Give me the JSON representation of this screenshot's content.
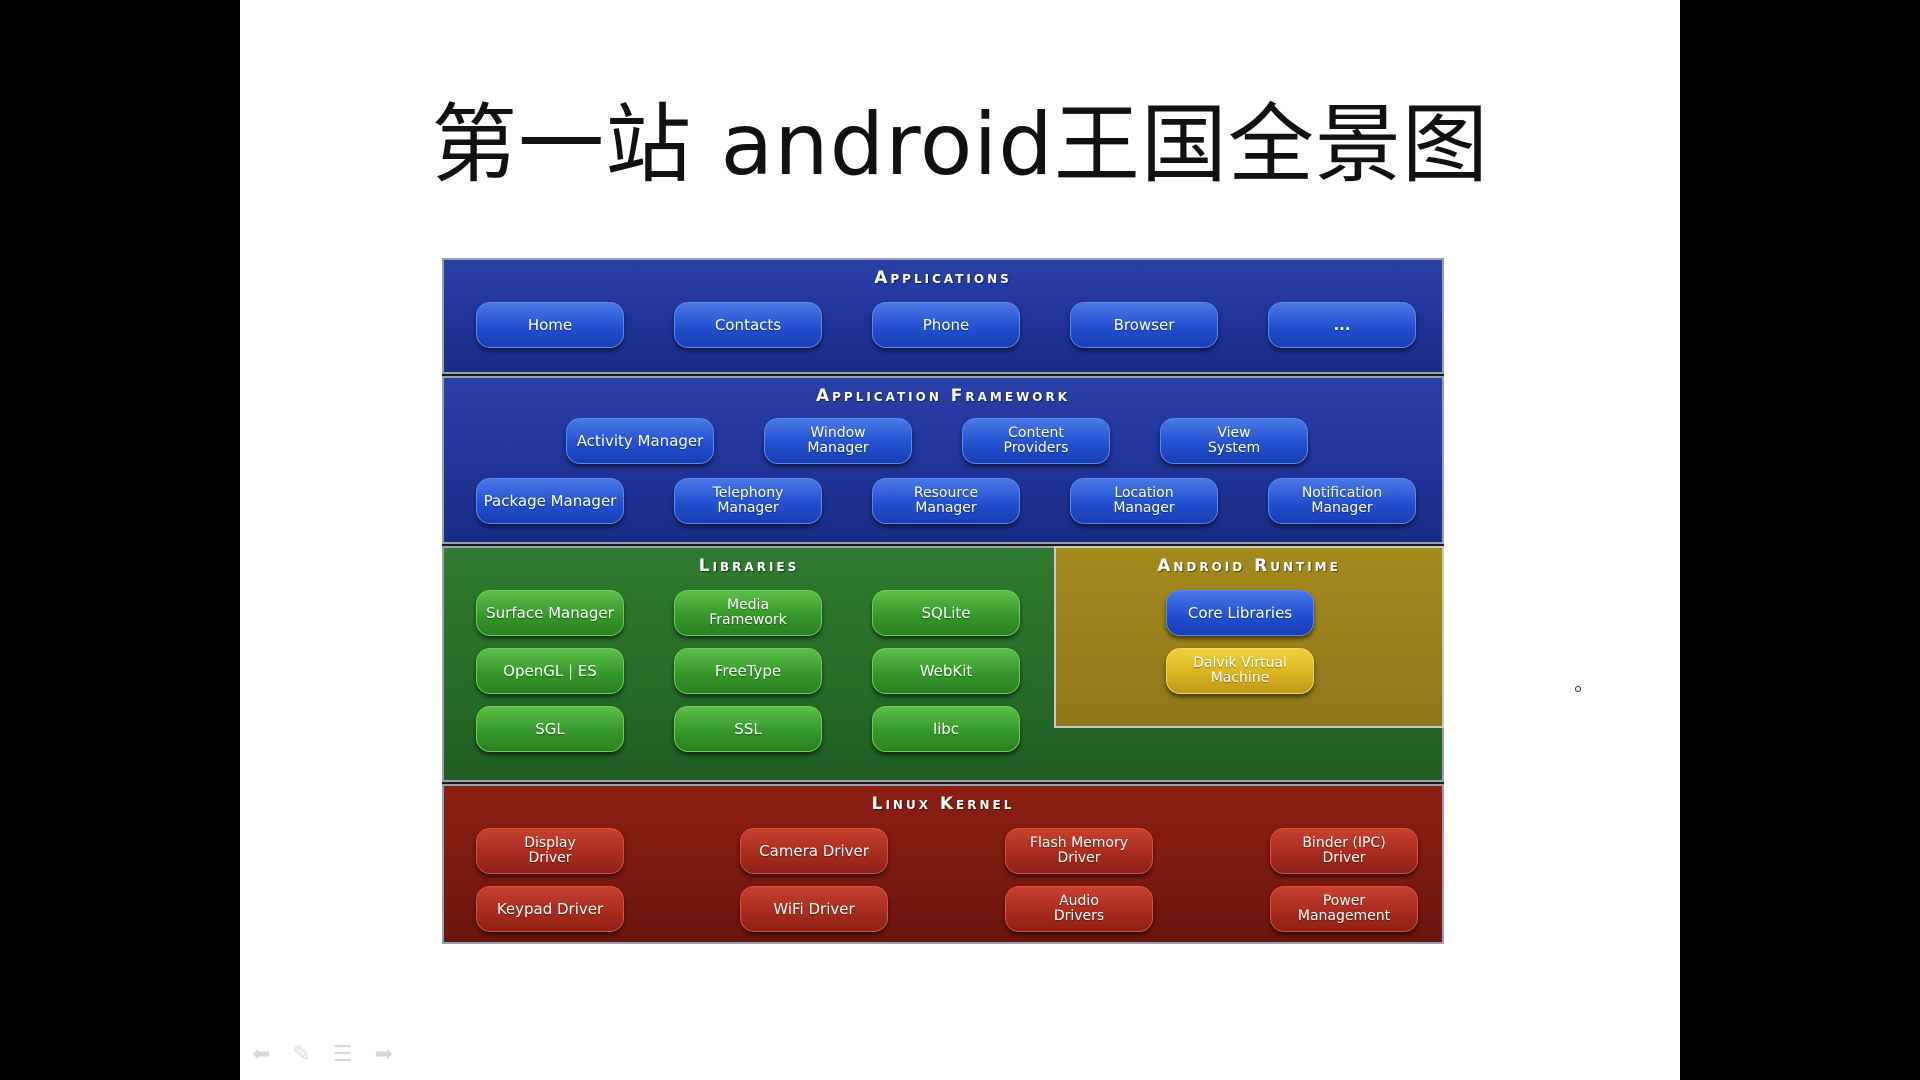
{
  "slide": {
    "title": "第一站 android王国全景图"
  },
  "diagram": {
    "applications": {
      "title": "Applications",
      "items": [
        "Home",
        "Contacts",
        "Phone",
        "Browser",
        "..."
      ]
    },
    "framework": {
      "title": "Application Framework",
      "row1": [
        "Activity Manager",
        "Window\nManager",
        "Content\nProviders",
        "View\nSystem"
      ],
      "row2": [
        "Package Manager",
        "Telephony\nManager",
        "Resource\nManager",
        "Location\nManager",
        "Notification\nManager"
      ]
    },
    "libraries": {
      "title": "Libraries",
      "items": [
        "Surface Manager",
        "Media\nFramework",
        "SQLite",
        "OpenGL | ES",
        "FreeType",
        "WebKit",
        "SGL",
        "SSL",
        "libc"
      ]
    },
    "runtime": {
      "title": "Android Runtime",
      "items": [
        "Core Libraries",
        "Dalvik Virtual\nMachine"
      ]
    },
    "kernel": {
      "title": "Linux Kernel",
      "items": [
        "Display\nDriver",
        "Camera Driver",
        "Flash Memory\nDriver",
        "Binder (IPC)\nDriver",
        "Keypad Driver",
        "WiFi Driver",
        "Audio\nDrivers",
        "Power\nManagement"
      ]
    }
  },
  "nav": {
    "icons": [
      "prev-arrow-icon",
      "pen-icon",
      "menu-icon",
      "next-arrow-icon"
    ]
  }
}
